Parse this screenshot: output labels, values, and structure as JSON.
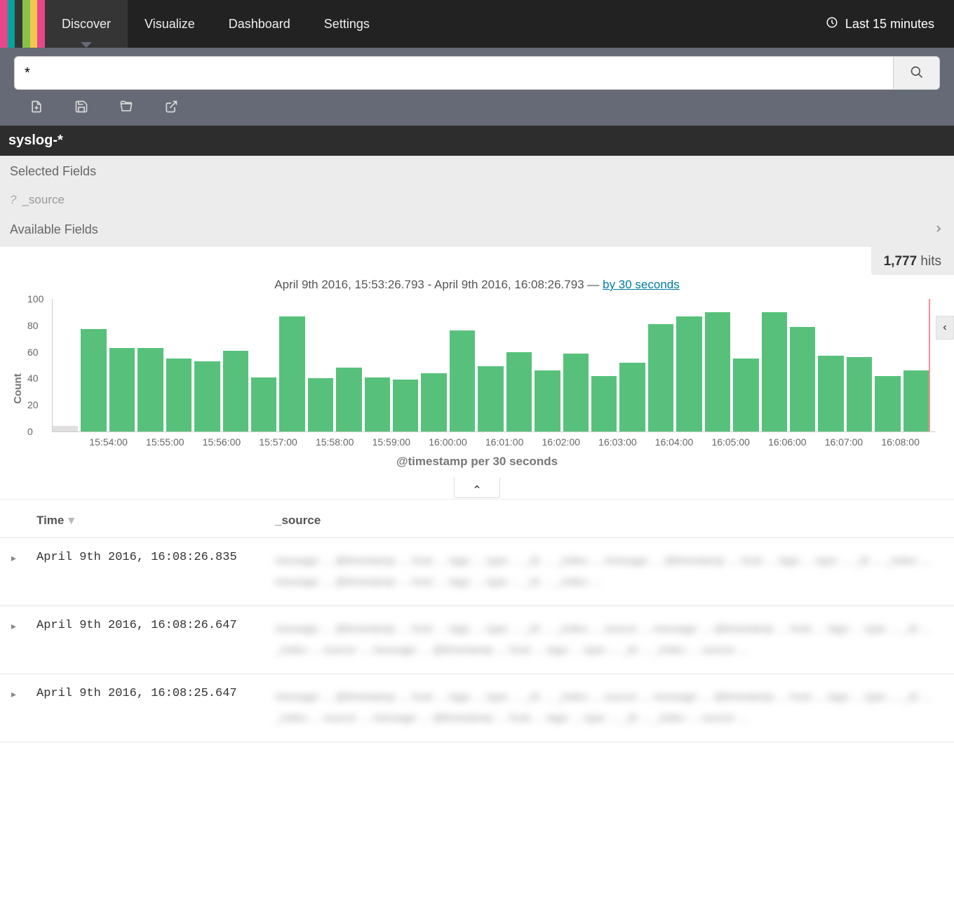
{
  "nav": {
    "items": [
      "Discover",
      "Visualize",
      "Dashboard",
      "Settings"
    ],
    "active": 0,
    "time_label": "Last 15 minutes"
  },
  "search": {
    "query": "*"
  },
  "index_pattern": "syslog-*",
  "fields": {
    "selected_title": "Selected Fields",
    "selected": [
      "_source"
    ],
    "available_title": "Available Fields"
  },
  "hits": {
    "count": "1,777",
    "label": "hits"
  },
  "chart_title": {
    "range_from": "April 9th 2016, 15:53:26.793",
    "range_to": "April 9th 2016, 16:08:26.793",
    "sep": " - ",
    "dash": " — ",
    "interval_link": "by 30 seconds"
  },
  "chart_data": {
    "type": "bar",
    "ylabel": "Count",
    "xlabel": "@timestamp per 30 seconds",
    "ylim": [
      0,
      100
    ],
    "yticks": [
      0,
      20,
      40,
      60,
      80,
      100
    ],
    "categories_major": [
      "15:54:00",
      "15:55:00",
      "15:56:00",
      "15:57:00",
      "15:58:00",
      "15:59:00",
      "16:00:00",
      "16:01:00",
      "16:02:00",
      "16:03:00",
      "16:04:00",
      "16:05:00",
      "16:06:00",
      "16:07:00",
      "16:08:00"
    ],
    "values": [
      4,
      77,
      63,
      63,
      55,
      53,
      61,
      41,
      87,
      40,
      48,
      41,
      39,
      44,
      76,
      49,
      60,
      46,
      59,
      42,
      52,
      81,
      87,
      90,
      55,
      90,
      79,
      57,
      56,
      42,
      46
    ]
  },
  "table": {
    "columns": {
      "time": "Time",
      "source": "_source"
    },
    "rows": [
      {
        "time": "April 9th 2016, 16:08:26.835",
        "source": "message: ... @timestamp: ... host: ... tags: ... type: ... _id: ... _index: ..."
      },
      {
        "time": "April 9th 2016, 16:08:26.647",
        "source": "message: ... @timestamp: ... host: ... tags: ... type: ... _id: ... _index: ... source: ..."
      },
      {
        "time": "April 9th 2016, 16:08:25.647",
        "source": "message: ... @timestamp: ... host: ... tags: ... type: ... _id: ... _index: ... source: ..."
      }
    ]
  }
}
